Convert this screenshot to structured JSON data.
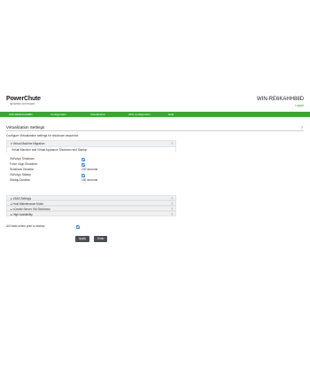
{
  "header": {
    "logo_text": "PowerChute",
    "logo_sub": "NETWORK SHUTDOWN",
    "host": "WIN-RE6KAHH88D",
    "logout": "Logout"
  },
  "nav": [
    "WIN-RE6KAHH88D",
    "Configuration",
    "Virtualization",
    "UPS Configuration",
    "Help"
  ],
  "page": {
    "title": "Virtualization Settings",
    "help": "?",
    "description": "Configure Virtualization settings for shutdown sequence."
  },
  "vm_migration": {
    "label": "Virtual Machine Migration",
    "help": "?",
    "sub_label": "Virtual Machine and Virtual Appliance Shutdown and Startup"
  },
  "vm_settings": [
    {
      "label": "VM/vApp Shutdown",
      "checked": true
    },
    {
      "label": "Force vApp Shutdown",
      "checked": true
    },
    {
      "label": "Shutdown Duration",
      "value": "120 seconds"
    },
    {
      "label": "VM/vApp Startup",
      "checked": true
    },
    {
      "label": "Startup Duration",
      "value": "150 seconds"
    }
  ],
  "collapsed_sections": [
    {
      "label": "vSAN Settings",
      "help": "?"
    },
    {
      "label": "Host Maintenance Mode",
      "help": "?"
    },
    {
      "label": "vCenter Server VM Shutdown",
      "help": "?"
    },
    {
      "label": "High Availability",
      "help": "?"
    }
  ],
  "wait_hosts": {
    "label": "All Hosts online prior to startup",
    "checked": true
  },
  "buttons": {
    "apply": "Apply",
    "undo": "Undo"
  },
  "colors": {
    "nav_green": "#3da535",
    "checkbox_blue": "#2f7fd6",
    "button_dark": "#4a4f55"
  }
}
